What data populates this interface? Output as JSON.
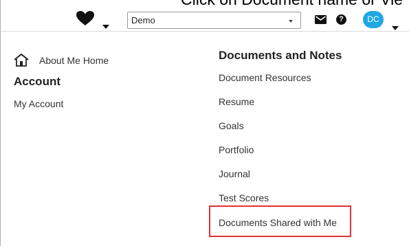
{
  "caption": "Click on Document name or Vie",
  "header": {
    "favorites_icon": "heart-icon",
    "account_select": {
      "value": "Demo"
    },
    "mail_icon": "envelope-icon",
    "help_icon": "question-icon",
    "help_glyph": "?",
    "avatar_initials": "DC"
  },
  "left_menu": {
    "home_label": "About Me Home",
    "account_heading": "Account",
    "my_account": "My Account"
  },
  "documents": {
    "heading": "Documents and Notes",
    "items": [
      "Document Resources",
      "Resume",
      "Goals",
      "Portfolio",
      "Journal",
      "Test Scores",
      "Documents Shared with Me"
    ]
  },
  "colors": {
    "avatar_bg": "#1fa8e0",
    "highlight_border": "#e0303a"
  }
}
